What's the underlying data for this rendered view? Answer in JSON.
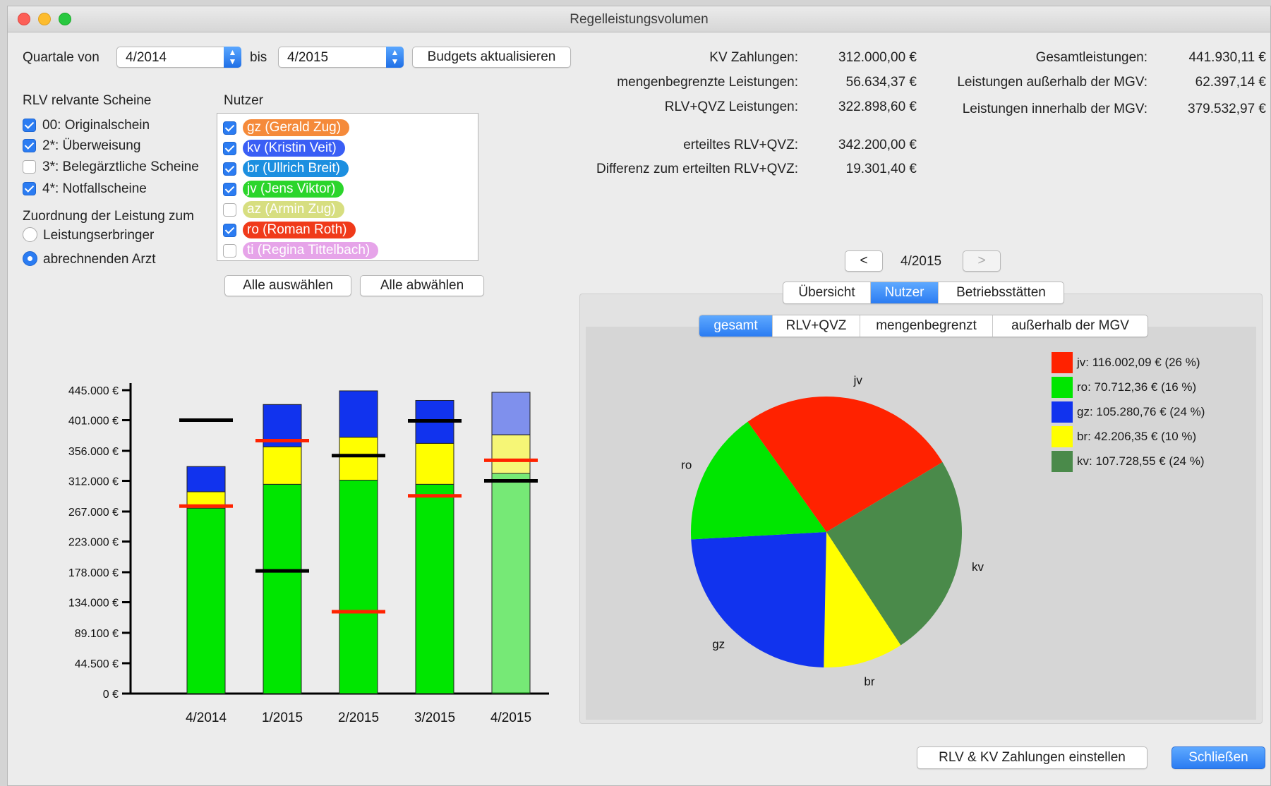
{
  "window": {
    "title": "Regelleistungsvolumen"
  },
  "filters": {
    "quarters_from_label": "Quartale von",
    "quarters_from_value": "4/2014",
    "to_label": "bis",
    "quarters_to_value": "4/2015",
    "update_button": "Budgets aktualisieren"
  },
  "scheine": {
    "title": "RLV relvante Scheine",
    "items": [
      {
        "label": "00: Originalschein",
        "checked": true
      },
      {
        "label": "2*: Überweisung",
        "checked": true
      },
      {
        "label": "3*: Belegärztliche Scheine",
        "checked": false
      },
      {
        "label": "4*: Notfallscheine",
        "checked": true
      }
    ]
  },
  "zuordnung": {
    "title": "Zuordnung der Leistung zum",
    "options": [
      {
        "label": "Leistungserbringer",
        "selected": false
      },
      {
        "label": "abrechnenden Arzt",
        "selected": true
      }
    ]
  },
  "nutzer": {
    "title": "Nutzer",
    "items": [
      {
        "label": "gz (Gerald Zug)",
        "checked": true,
        "color": "#f58a3a"
      },
      {
        "label": "kv (Kristin Veit)",
        "checked": true,
        "color": "#3a5ef5"
      },
      {
        "label": "br (Ullrich Breit)",
        "checked": true,
        "color": "#1c8fe0"
      },
      {
        "label": "jv (Jens Viktor)",
        "checked": true,
        "color": "#2bd52b"
      },
      {
        "label": "az (Armin Zug)",
        "checked": false,
        "color": "#b8c41a"
      },
      {
        "label": "ro (Roman Roth)",
        "checked": true,
        "color": "#f03a1a"
      },
      {
        "label": "ti (Regina Tittelbach)",
        "checked": false,
        "color": "#d25ad8"
      },
      {
        "label": "",
        "checked": false,
        "color": "#e04ad0"
      }
    ],
    "select_all": "Alle auswählen",
    "deselect_all": "Alle abwählen"
  },
  "summary": {
    "left": [
      {
        "label": "KV Zahlungen:",
        "value": "312.000,00 €"
      },
      {
        "label": "mengenbegrenzte Leistungen:",
        "value": "56.634,37 €"
      },
      {
        "label": "RLV+QVZ Leistungen:",
        "value": "322.898,60 €"
      },
      {
        "label": "erteiltes RLV+QVZ:",
        "value": "342.200,00 €"
      },
      {
        "label": "Differenz zum erteilten RLV+QVZ:",
        "value": "19.301,40 €"
      }
    ],
    "right": [
      {
        "label": "Gesamtleistungen:",
        "value": "441.930,11 €"
      },
      {
        "label": "Leistungen außerhalb der MGV:",
        "value": "62.397,14 €"
      },
      {
        "label": "Leistungen innerhalb der MGV:",
        "value": "379.532,97 €"
      }
    ]
  },
  "quarter_nav": {
    "prev": "<",
    "current": "4/2015",
    "next": ">"
  },
  "main_tabs": {
    "items": [
      "Übersicht",
      "Nutzer",
      "Betriebsstätten"
    ],
    "selected": 1
  },
  "sub_tabs": {
    "items": [
      "gesamt",
      "RLV+QVZ",
      "mengenbegrenzt",
      "außerhalb der MGV"
    ],
    "selected": 0
  },
  "buttons": {
    "rlv_kv": "RLV & KV Zahlungen einstellen",
    "close": "Schließen"
  },
  "chart_data": [
    {
      "type": "bar",
      "stacked": true,
      "categories": [
        "4/2014",
        "1/2015",
        "2/2015",
        "3/2015",
        "4/2015"
      ],
      "y_tick_labels": [
        "0 €",
        "44.500 €",
        "89.100 €",
        "134.000 €",
        "178.000 €",
        "223.000 €",
        "267.000 €",
        "312.000 €",
        "356.000 €",
        "401.000 €",
        "445.000 €"
      ],
      "y_ticks": [
        0,
        44500,
        89100,
        134000,
        178000,
        223000,
        267000,
        312000,
        356000,
        401000,
        445000
      ],
      "ylim": [
        0,
        445000
      ],
      "series": [
        {
          "values": [
            272000,
            307000,
            313000,
            307000,
            322898.6
          ],
          "color": "#00e600"
        },
        {
          "values": [
            24000,
            55000,
            63000,
            60000,
            56634.37
          ],
          "color": "#ffff00"
        },
        {
          "values": [
            37000,
            62000,
            68000,
            63000,
            62397.14
          ],
          "color": "#1133ee"
        }
      ],
      "faded_category_index": 4,
      "red_markers": [
        275000,
        371000,
        120000,
        290000,
        342200
      ],
      "black_markers": [
        401000,
        180000,
        349000,
        400000,
        312000
      ],
      "marker_colors": {
        "red": "#ff2200",
        "black": "#000000"
      }
    },
    {
      "type": "pie",
      "slices": [
        {
          "label": "jv",
          "value": 116002.09,
          "percent": 26,
          "color": "#ff2200",
          "legend": "jv: 116.002,09 € (26 %)"
        },
        {
          "label": "kv",
          "value": 107728.55,
          "percent": 24,
          "color": "#4a8a4a",
          "legend": "kv: 107.728,55 € (24 %)"
        },
        {
          "label": "br",
          "value": 42206.35,
          "percent": 10,
          "color": "#ffff00",
          "legend": "br: 42.206,35 € (10 %)"
        },
        {
          "label": "gz",
          "value": 105280.76,
          "percent": 24,
          "color": "#1133ee",
          "legend": "gz: 105.280,76 € (24 %)"
        },
        {
          "label": "ro",
          "value": 70712.36,
          "percent": 16,
          "color": "#00e600",
          "legend": "ro: 70.712,36 € (16 %)"
        }
      ],
      "legend_order": [
        "jv",
        "ro",
        "gz",
        "br",
        "kv"
      ],
      "legend_placement": "right"
    }
  ]
}
